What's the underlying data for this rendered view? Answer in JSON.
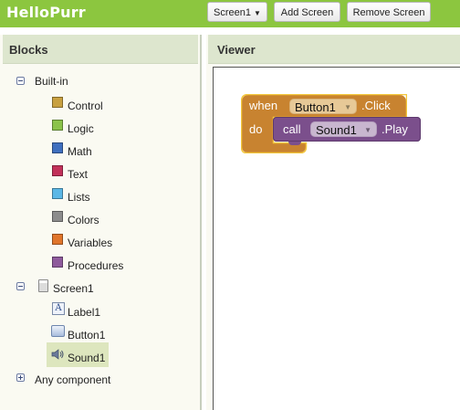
{
  "app": {
    "title": "HelloPurr"
  },
  "toolbar": {
    "screen_select": "Screen1",
    "add_screen": "Add Screen",
    "remove_screen": "Remove Screen"
  },
  "blocks_panel": {
    "title": "Blocks",
    "builtin": {
      "label": "Built-in",
      "items": [
        {
          "label": "Control",
          "color": "#c8a040"
        },
        {
          "label": "Logic",
          "color": "#8bc34a"
        },
        {
          "label": "Math",
          "color": "#3f6fbf"
        },
        {
          "label": "Text",
          "color": "#c2315a"
        },
        {
          "label": "Lists",
          "color": "#5bb7e6"
        },
        {
          "label": "Colors",
          "color": "#8c8c8c"
        },
        {
          "label": "Variables",
          "color": "#e0752b"
        },
        {
          "label": "Procedures",
          "color": "#8e5a9c"
        }
      ]
    },
    "screen": {
      "label": "Screen1",
      "components": [
        {
          "label": "Label1",
          "icon": "label-icon"
        },
        {
          "label": "Button1",
          "icon": "button-icon"
        },
        {
          "label": "Sound1",
          "icon": "speaker-icon"
        }
      ]
    },
    "any_component": "Any component",
    "selected": "Sound1"
  },
  "viewer": {
    "title": "Viewer",
    "event_block": {
      "when": "when",
      "component": "Button1",
      "event": ".Click",
      "do": "do",
      "color": "#c88330"
    },
    "call_block": {
      "call": "call",
      "component": "Sound1",
      "method": ".Play",
      "color": "#7b4f8c"
    }
  }
}
